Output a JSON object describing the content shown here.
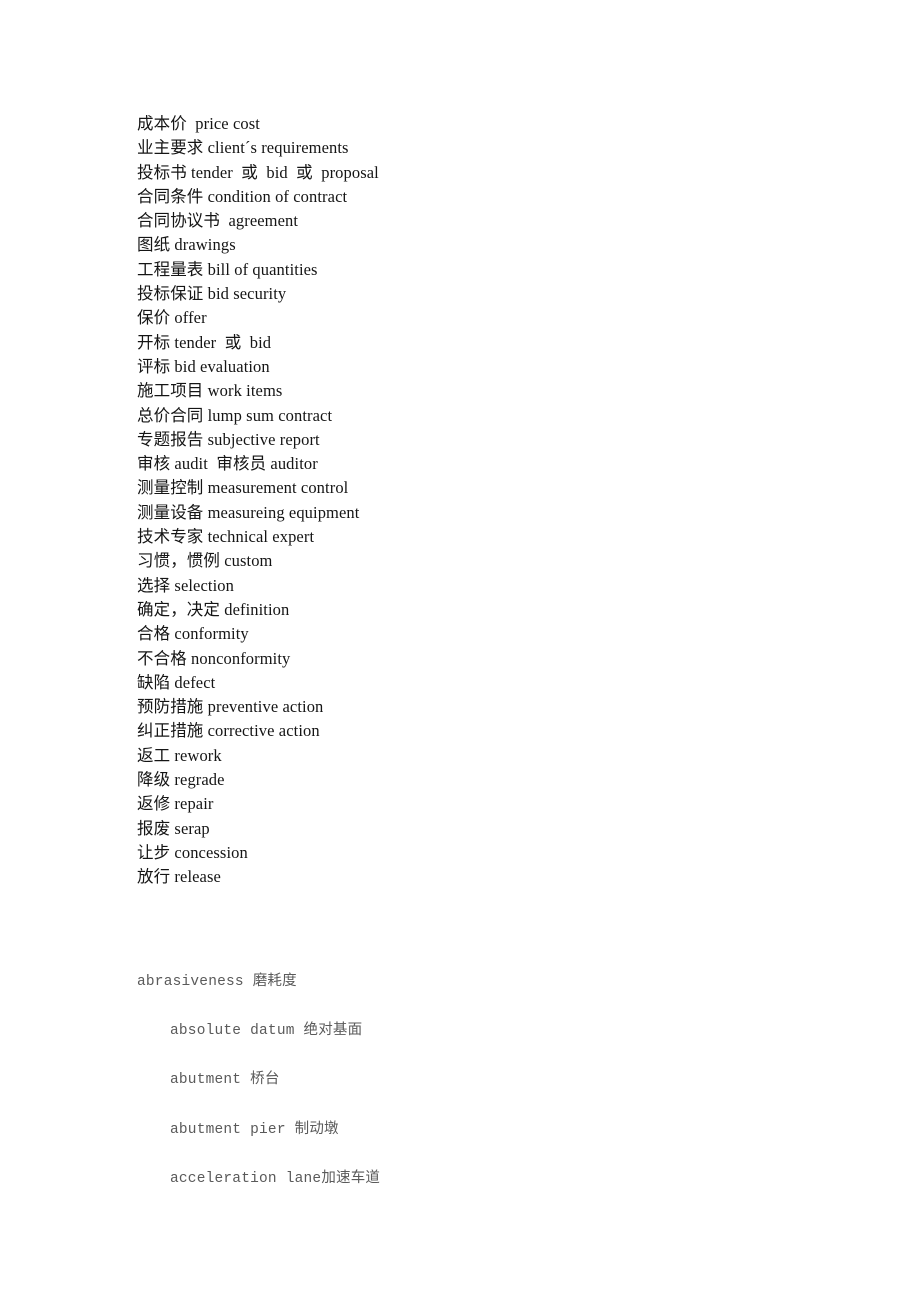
{
  "document": {
    "title": "Bilingual Construction Glossary",
    "background_color": "#ffffff",
    "serif_text_color": "#151515",
    "mono_text_color": "#5a5a5a"
  },
  "glossary_serif": {
    "entries": [
      {
        "text": "成本价  price cost"
      },
      {
        "text": "业主要求 client´s requirements"
      },
      {
        "text": "投标书 tender  或  bid  或  proposal"
      },
      {
        "text": "合同条件 condition of contract"
      },
      {
        "text": "合同协议书  agreement"
      },
      {
        "text": "图纸 drawings"
      },
      {
        "text": "工程量表 bill of quantities"
      },
      {
        "text": "投标保证 bid security"
      },
      {
        "text": "保价 offer"
      },
      {
        "text": "开标 tender  或  bid"
      },
      {
        "text": "评标 bid evaluation"
      },
      {
        "text": "施工项目 work items"
      },
      {
        "text": "总价合同 lump sum contract"
      },
      {
        "text": "专题报告 subjective report"
      },
      {
        "text": "审核 audit  审核员 auditor"
      },
      {
        "text": "测量控制 measurement control"
      },
      {
        "text": "测量设备 measureing equipment"
      },
      {
        "text": "技术专家 technical expert"
      },
      {
        "text": "习惯，惯例 custom"
      },
      {
        "text": "选择 selection"
      },
      {
        "text": "确定，决定 definition"
      },
      {
        "text": "合格 conformity"
      },
      {
        "text": "不合格 nonconformity"
      },
      {
        "text": "缺陷 defect"
      },
      {
        "text": "预防措施 preventive action"
      },
      {
        "text": "纠正措施 corrective action"
      },
      {
        "text": "返工 rework"
      },
      {
        "text": "降级 regrade"
      },
      {
        "text": "返修 repair"
      },
      {
        "text": "报废 serap"
      },
      {
        "text": "让步 concession"
      },
      {
        "text": "放行 release"
      }
    ]
  },
  "glossary_mono": {
    "entries": [
      {
        "text": "abrasiveness 磨耗度",
        "indented": false
      },
      {
        "text": "absolute datum 绝对基面",
        "indented": true
      },
      {
        "text": "abutment 桥台",
        "indented": true
      },
      {
        "text": "abutment pier 制动墩",
        "indented": true
      },
      {
        "text": "acceleration lane加速车道",
        "indented": true
      }
    ]
  }
}
